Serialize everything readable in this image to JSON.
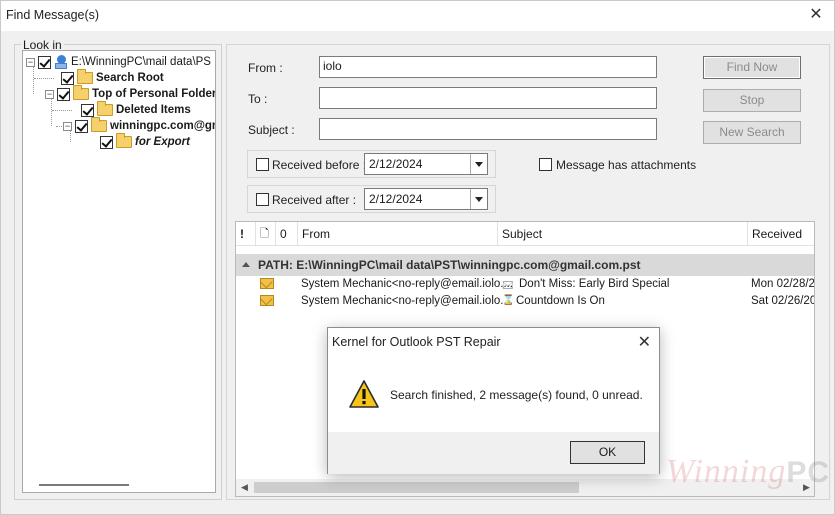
{
  "window": {
    "title": "Find Message(s)",
    "close_glyph": "✕"
  },
  "look_in": {
    "label": "Look in",
    "tree": [
      {
        "label": "E:\\WinningPC\\mail data\\PS",
        "checked": true,
        "icon": "computer-icon"
      },
      {
        "label": "Search Root",
        "checked": true,
        "icon": "folder-icon"
      },
      {
        "label": "Top of Personal Folder",
        "checked": true,
        "icon": "folder-icon"
      },
      {
        "label": "Deleted Items",
        "checked": true,
        "icon": "folder-icon"
      },
      {
        "label": "winningpc.com@gm",
        "checked": true,
        "icon": "folder-icon"
      },
      {
        "label": "for Export",
        "checked": true,
        "icon": "folder-icon"
      }
    ]
  },
  "search": {
    "from_label": "From :",
    "from_value": "iolo",
    "to_label": "To :",
    "to_value": "",
    "subject_label": "Subject :",
    "subject_value": "",
    "received_before_label": "Received before :",
    "received_before_value": "2/12/2024",
    "received_after_label": "Received after :",
    "received_after_value": "2/12/2024",
    "attachments_label": "Message has attachments"
  },
  "buttons": {
    "find_now": "Find Now",
    "stop": "Stop",
    "new_search": "New Search"
  },
  "results": {
    "columns": {
      "importance": "!",
      "type": "🗋",
      "attachment": "0",
      "from": "From",
      "subject": "Subject",
      "received": "Received"
    },
    "group_path": "PATH: E:\\WinningPC\\mail data\\PST\\winningpc.com@gmail.com.pst",
    "rows": [
      {
        "from": "System Mechanic<no-reply@email.iolo....",
        "subject_icon": "🖂",
        "subject": "Don't Miss: Early Bird Special",
        "received": "Mon 02/28/2"
      },
      {
        "from": "System Mechanic<no-reply@email.iolo....",
        "subject_icon": "⌛",
        "subject": "Countdown Is On",
        "received": "Sat 02/26/20"
      }
    ]
  },
  "dialog": {
    "title": "Kernel for Outlook PST Repair",
    "message": "Search finished, 2 message(s) found, 0 unread.",
    "ok_label": "OK",
    "close_glyph": "✕"
  },
  "watermark": {
    "text_a": "Winning",
    "text_b": "PC"
  }
}
